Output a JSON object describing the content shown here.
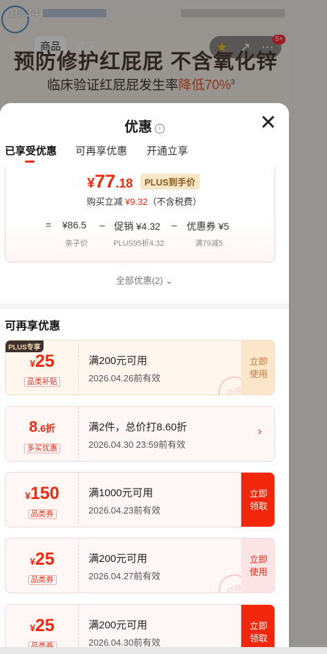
{
  "status_bar": {
    "time": "16:34"
  },
  "header": {
    "back_icon": "back-arrow-icon",
    "tab_goods": "商品",
    "tab_review": "测评",
    "cart_badge": "5+"
  },
  "hero": {
    "title": "预防修护红屁屁 不含氧化锌",
    "sub_prefix": "临床验证红屁屁发生率",
    "sub_highlight": "降低70%",
    "sub_sup": "3"
  },
  "sheet": {
    "title": "优惠",
    "tabs": [
      "已享受优惠",
      "可再享优惠",
      "开通立享"
    ],
    "price": {
      "currency": "¥",
      "integer": "77",
      "decimal": ".18",
      "plus_tag": "PLUS到手价",
      "reduce_prefix": "购买立减",
      "reduce_amount": "¥9.32",
      "reduce_suffix": "（不含税费）",
      "formula": [
        "=",
        "¥86.5",
        "–",
        "促销 ¥4.32",
        "–",
        "优惠券 ¥5"
      ],
      "formula_sub": [
        "亲子价",
        "PLUS95折4.32",
        "满79减5"
      ]
    },
    "all_offers": "全部优惠(2)",
    "more_section_title": "可再享优惠",
    "coupons": [
      {
        "cur": "¥",
        "num": "25",
        "unit": "",
        "tag": "品类补贴",
        "cond": "满200元可用",
        "date": "2026.04.26前有效",
        "action": "立即\n使用",
        "plus": "PLUS专享",
        "stamp": "已领"
      },
      {
        "cur": "",
        "num": "8",
        "unit": ".6折",
        "tag": "多买优惠",
        "cond": "满2件，总价打8.60折",
        "date": "2026.04.30 23:59前有效",
        "action": ""
      },
      {
        "cur": "¥",
        "num": "150",
        "unit": "",
        "tag": "品类券",
        "cond": "满1000元可用",
        "date": "2026.04.23前有效",
        "action": "立即\n领取"
      },
      {
        "cur": "¥",
        "num": "25",
        "unit": "",
        "tag": "品类券",
        "cond": "满200元可用",
        "date": "2026.04.27前有效",
        "action": "立即\n使用",
        "stamp": "已领"
      },
      {
        "cur": "¥",
        "num": "25",
        "unit": "",
        "tag": "品类券",
        "cond": "满200元可用",
        "date": "2026.04.30前有效",
        "action": "立即\n领取"
      }
    ]
  },
  "colors": {
    "accent": "#f2270c",
    "plus_gold": "#8a5a1e"
  }
}
